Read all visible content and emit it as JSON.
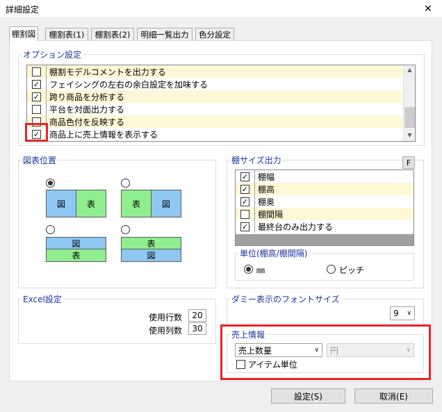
{
  "window": {
    "title": "詳細設定",
    "close_glyph": "✕"
  },
  "tabs": [
    {
      "label": "棚割図",
      "active": true
    },
    {
      "label": "棚割表(1)",
      "active": false
    },
    {
      "label": "棚割表(2)",
      "active": false
    },
    {
      "label": "明細一覧出力",
      "active": false
    },
    {
      "label": "色分設定",
      "active": false
    }
  ],
  "options": {
    "label": "オプション設定",
    "items": [
      {
        "label": "棚割モデルコメントを出力する",
        "checked": false
      },
      {
        "label": "フェイシングの左右の余白設定を加味する",
        "checked": true
      },
      {
        "label": "跨り商品を分析する",
        "checked": true
      },
      {
        "label": "平台を対面出力する",
        "checked": false
      },
      {
        "label": "商品色付を反映する",
        "checked": false
      },
      {
        "label": "商品上に売上情報を表示する",
        "checked": true
      }
    ]
  },
  "chart_pos": {
    "label": "図表位置",
    "fig": "図",
    "table": "表"
  },
  "size_output": {
    "label": "棚サイズ出力",
    "f_button": "F",
    "items": [
      {
        "label": "棚幅",
        "checked": true
      },
      {
        "label": "棚高",
        "checked": true
      },
      {
        "label": "棚奥",
        "checked": true
      },
      {
        "label": "棚間隔",
        "checked": false
      },
      {
        "label": "最終台のみ出力する",
        "checked": true
      }
    ],
    "unit_label": "単位(棚高/棚間隔)",
    "unit_mm": "㎜",
    "unit_pitch": "ピッチ"
  },
  "excel": {
    "label": "Excel設定",
    "rows_label": "使用行数",
    "rows_value": "20",
    "cols_label": "使用列数",
    "cols_value": "30"
  },
  "dummy_font": {
    "label": "ダミー表示のフォントサイズ",
    "value": "9"
  },
  "sales": {
    "label": "売上情報",
    "select1": "売上数量",
    "select2": "円",
    "item_unit": "アイテム単位"
  },
  "buttons": {
    "ok": "設定(S)",
    "cancel": "取消(E)"
  },
  "check_glyph": "✓",
  "arrow_up": "▲",
  "arrow_down": "▼",
  "chevron": "∨"
}
